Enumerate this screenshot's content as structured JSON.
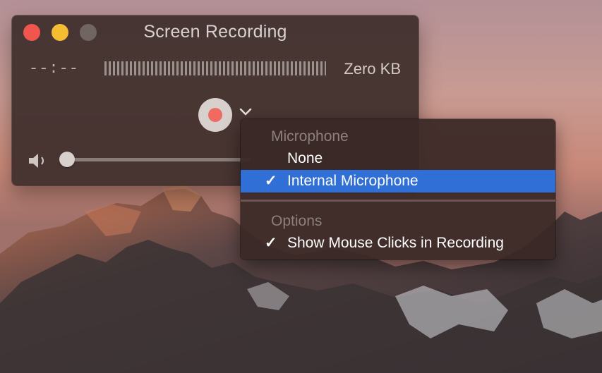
{
  "window": {
    "title": "Screen Recording",
    "elapsed_time": "--:--",
    "file_size": "Zero KB",
    "volume_level": 0.0
  },
  "menu": {
    "section_microphone": "Microphone",
    "items_microphone": [
      {
        "label": "None",
        "checked": false,
        "highlighted": false
      },
      {
        "label": "Internal Microphone",
        "checked": true,
        "highlighted": true
      }
    ],
    "section_options": "Options",
    "items_options": [
      {
        "label": "Show Mouse Clicks in Recording",
        "checked": true,
        "highlighted": false
      }
    ],
    "check_glyph": "✓"
  },
  "colors": {
    "close": "#f0564e",
    "minimize": "#f5bd32",
    "zoom_disabled": "#706560",
    "record": "#ef6a60",
    "menu_highlight": "#2f6fd6"
  },
  "icons": {
    "volume": "speaker-icon",
    "options": "chevron-down-icon",
    "record": "record-icon"
  }
}
